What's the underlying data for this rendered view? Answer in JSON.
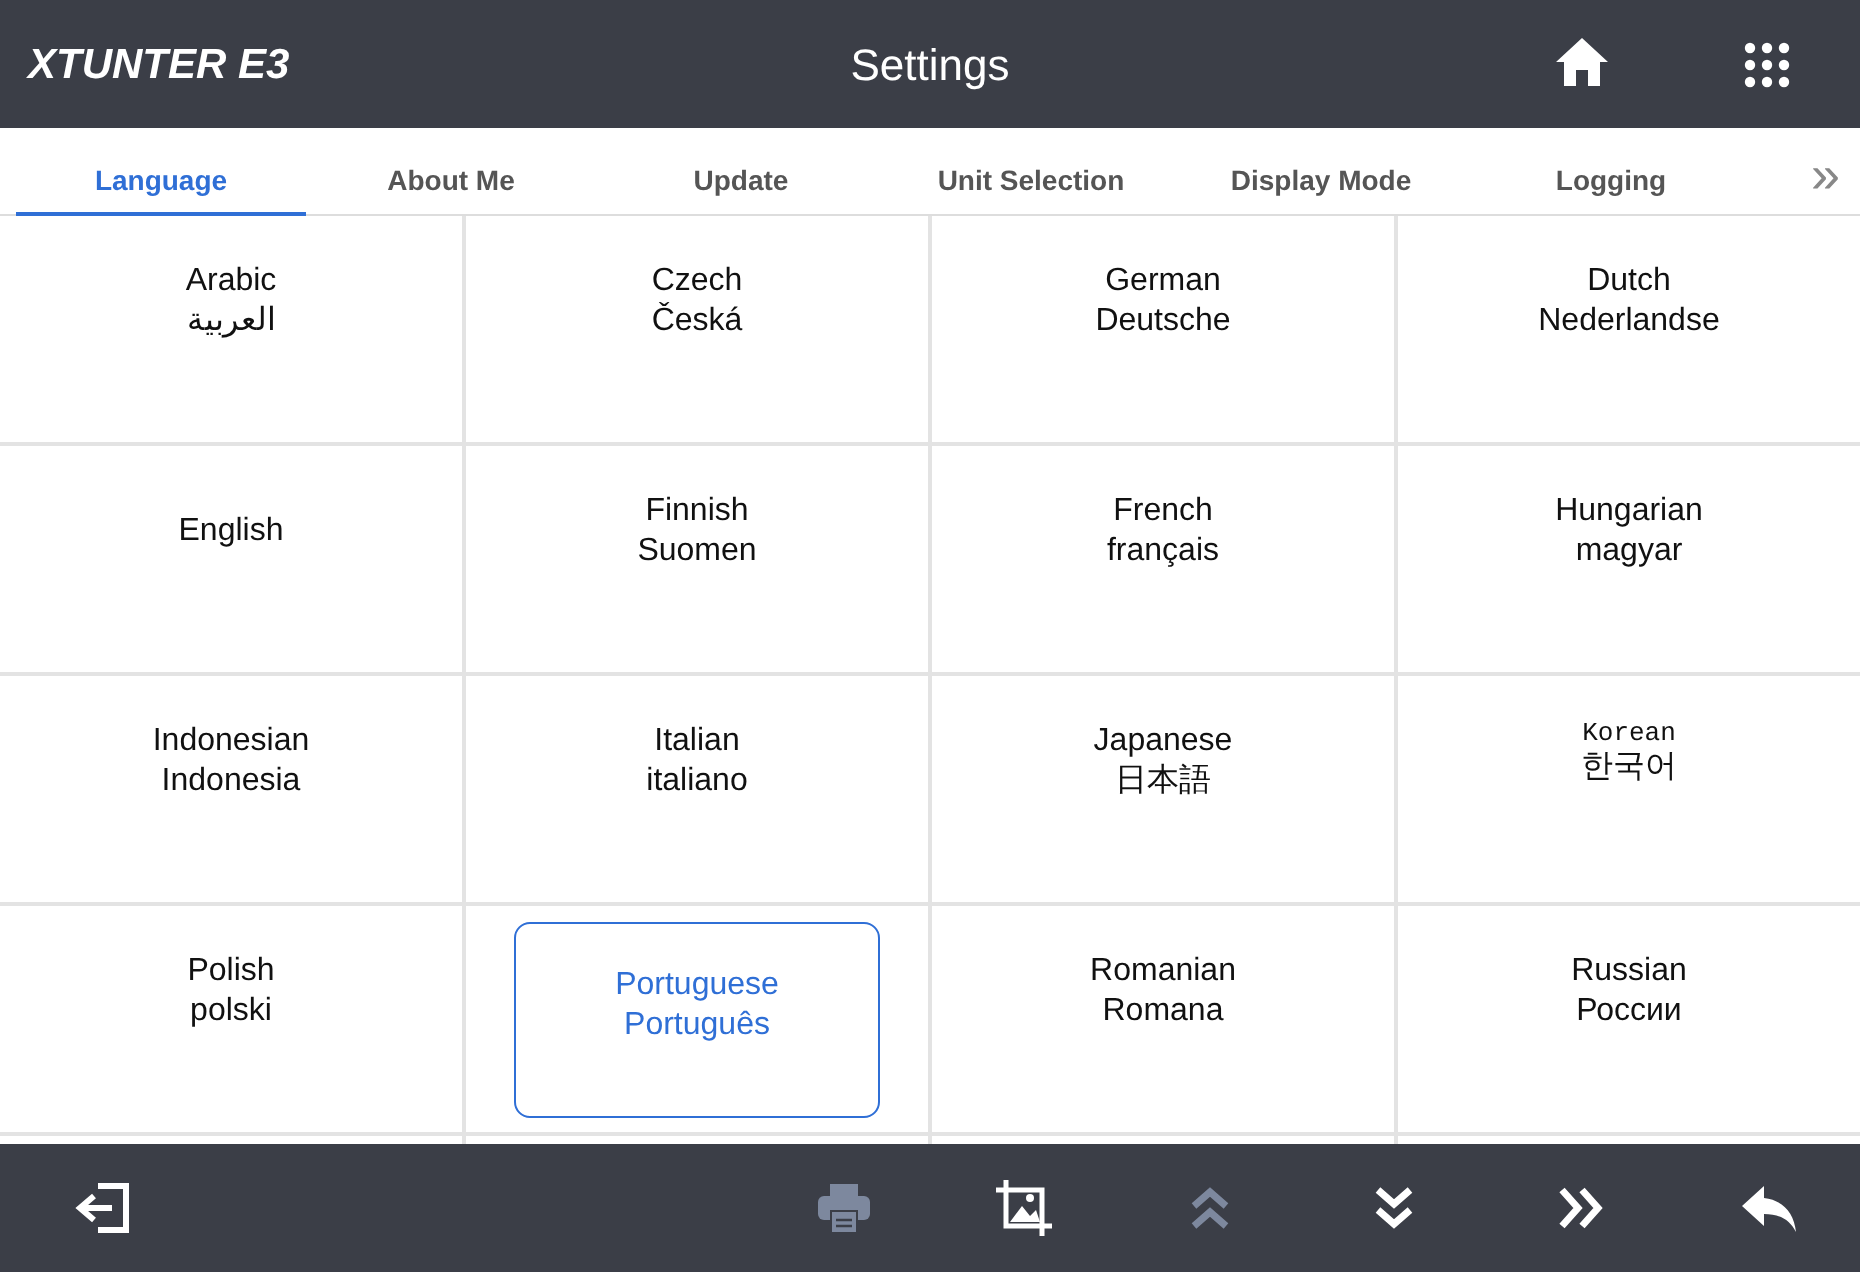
{
  "header": {
    "brand": "XTUNTER E3",
    "title": "Settings"
  },
  "tabs": [
    {
      "label": "Language",
      "selected": true
    },
    {
      "label": "About Me",
      "selected": false
    },
    {
      "label": "Update",
      "selected": false
    },
    {
      "label": "Unit Selection",
      "selected": false
    },
    {
      "label": "Display Mode",
      "selected": false
    },
    {
      "label": "Logging",
      "selected": false
    }
  ],
  "tabs_more": "»",
  "languages": [
    {
      "name": "Arabic",
      "native": "العربية",
      "selected": false,
      "kind": "sans"
    },
    {
      "name": "Czech",
      "native": "Česká",
      "selected": false,
      "kind": "sans"
    },
    {
      "name": "German",
      "native": "Deutsche",
      "selected": false,
      "kind": "sans"
    },
    {
      "name": "Dutch",
      "native": "Nederlandse",
      "selected": false,
      "kind": "sans"
    },
    {
      "name": "English",
      "selected": false,
      "kind": "sans"
    },
    {
      "name": "Finnish",
      "native": "Suomen",
      "selected": false,
      "kind": "sans"
    },
    {
      "name": "French",
      "native": "français",
      "selected": false,
      "kind": "sans"
    },
    {
      "name": "Hungarian",
      "native": "magyar",
      "selected": false,
      "kind": "sans"
    },
    {
      "name": "Indonesian",
      "native": "Indonesia",
      "selected": false,
      "kind": "sans"
    },
    {
      "name": "Italian",
      "native": "italiano",
      "selected": false,
      "kind": "sans"
    },
    {
      "name": "Japanese",
      "native": "日本語",
      "selected": false,
      "kind": "sans"
    },
    {
      "name": "Korean",
      "native": "한국어",
      "selected": false,
      "kind": "mono"
    },
    {
      "name": "Polish",
      "native": "polski",
      "selected": false,
      "kind": "sans"
    },
    {
      "name": "Portuguese",
      "native": "Português",
      "selected": true,
      "kind": "sans"
    },
    {
      "name": "Romanian",
      "native": "Romana",
      "selected": false,
      "kind": "sans"
    },
    {
      "name": "Russian",
      "native": "России",
      "selected": false,
      "kind": "sans"
    }
  ],
  "toolbar": [
    {
      "kind": "exit",
      "disabled": false
    },
    {
      "kind": "print",
      "disabled": true
    },
    {
      "kind": "image",
      "disabled": false
    },
    {
      "kind": "up",
      "disabled": true
    },
    {
      "kind": "down",
      "disabled": false
    },
    {
      "kind": "forward",
      "disabled": false
    },
    {
      "kind": "back",
      "disabled": false
    }
  ]
}
